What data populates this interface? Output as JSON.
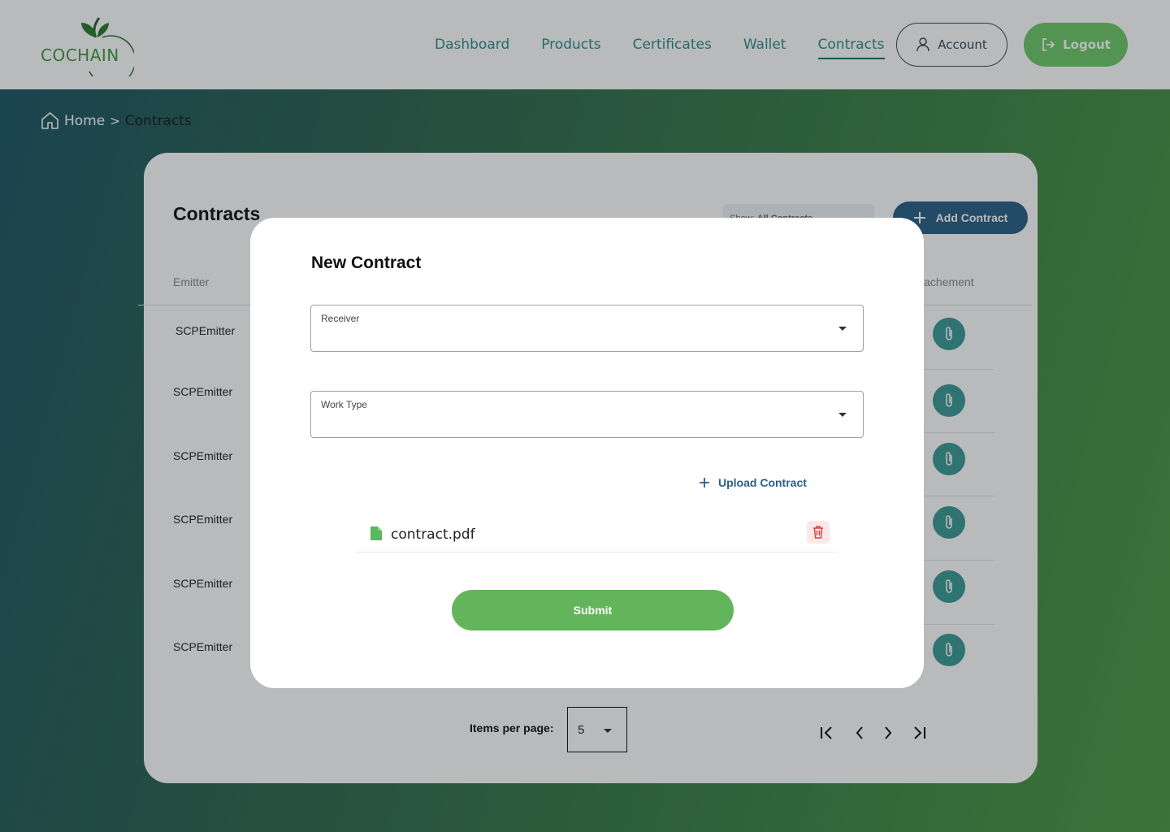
{
  "brand": {
    "name": "COCHAIN",
    "color": "#3f9a3f"
  },
  "nav": {
    "items": [
      {
        "label": "Dashboard",
        "active": false
      },
      {
        "label": "Products",
        "active": false
      },
      {
        "label": "Certificates",
        "active": false
      },
      {
        "label": "Wallet",
        "active": false
      },
      {
        "label": "Contracts",
        "active": true
      }
    ],
    "account_label": "Account",
    "logout_label": "Logout"
  },
  "breadcrumb": {
    "home": "Home",
    "separator": ">",
    "current": "Contracts"
  },
  "card": {
    "title": "Contracts",
    "filter": {
      "prefix": "Show:",
      "value": "All Contracts"
    },
    "add_label": "Add Contract",
    "columns": {
      "emitter": "Emitter",
      "attachment": "Attachement"
    },
    "rows": [
      {
        "emitter": "SCPEmitter"
      },
      {
        "emitter": "SCPEmitter"
      },
      {
        "emitter": "SCPEmitter"
      },
      {
        "emitter": "SCPEmitter"
      },
      {
        "emitter": "SCPEmitter"
      },
      {
        "emitter": "SCPEmitter"
      }
    ],
    "pagination": {
      "items_per_page_label": "Items per page:",
      "items_per_page": "5"
    }
  },
  "modal": {
    "title": "New Contract",
    "receiver_label": "Receiver",
    "work_type_label": "Work Type",
    "upload_label": "Upload Contract",
    "file_name": "contract.pdf",
    "submit_label": "Submit"
  },
  "colors": {
    "accent_green": "#62b55a",
    "nav_teal": "#2a8f8a",
    "primary_blue": "#2a5f86",
    "attach_teal": "#3b9a97",
    "delete_red": "#d93a3a"
  },
  "icons": [
    "home-icon",
    "user-icon",
    "logout-icon",
    "plus-icon",
    "paperclip-icon",
    "file-icon",
    "trash-icon",
    "chevron-down-icon",
    "first-page-icon",
    "prev-page-icon",
    "next-page-icon",
    "last-page-icon"
  ]
}
